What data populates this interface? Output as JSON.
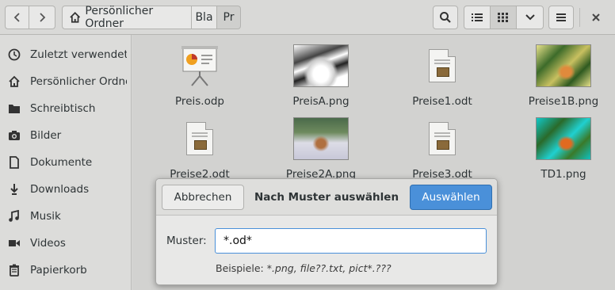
{
  "header": {
    "back_icon": "chevron-left-icon",
    "forward_icon": "chevron-right-icon",
    "breadcrumbs": [
      {
        "label": "Persönlicher Ordner",
        "icon": "home-icon"
      },
      {
        "label": "Bla"
      },
      {
        "label": "Pr"
      }
    ],
    "search_icon": "search-icon",
    "list_view_icon": "list-view-icon",
    "grid_view_icon": "grid-view-icon",
    "view_options_icon": "chevron-down-icon",
    "menu_icon": "hamburger-menu-icon",
    "close_icon": "close-icon"
  },
  "sidebar": {
    "items": [
      {
        "label": "Zuletzt verwendet",
        "icon": "clock-icon"
      },
      {
        "label": "Persönlicher Ordner",
        "icon": "home-icon"
      },
      {
        "label": "Schreibtisch",
        "icon": "folder-icon"
      },
      {
        "label": "Bilder",
        "icon": "camera-icon"
      },
      {
        "label": "Dokumente",
        "icon": "document-icon"
      },
      {
        "label": "Downloads",
        "icon": "download-icon"
      },
      {
        "label": "Musik",
        "icon": "music-icon"
      },
      {
        "label": "Videos",
        "icon": "video-icon"
      },
      {
        "label": "Papierkorb",
        "icon": "trash-icon"
      }
    ]
  },
  "files": [
    {
      "name": "Preis.odp",
      "icon": "presentation-icon"
    },
    {
      "name": "PreisA.png",
      "icon": "image-thumbnail"
    },
    {
      "name": "Preise1.odt",
      "icon": "text-document-icon"
    },
    {
      "name": "Preise1B.png",
      "icon": "image-thumbnail"
    },
    {
      "name": "Preise2.odt",
      "icon": "text-document-icon"
    },
    {
      "name": "Preise2A.png",
      "icon": "image-thumbnail"
    },
    {
      "name": "Preise3.odt",
      "icon": "text-document-icon"
    },
    {
      "name": "TD1.png",
      "icon": "image-thumbnail"
    }
  ],
  "dialog": {
    "title": "Nach Muster auswählen",
    "cancel_label": "Abbrechen",
    "confirm_label": "Auswählen",
    "field_label": "Muster:",
    "field_value": "*.od*",
    "hint_prefix": "Beispiele: ",
    "hint_examples": "*.png, file??.txt, pict*.???"
  },
  "colors": {
    "accent": "#4a90d9"
  }
}
